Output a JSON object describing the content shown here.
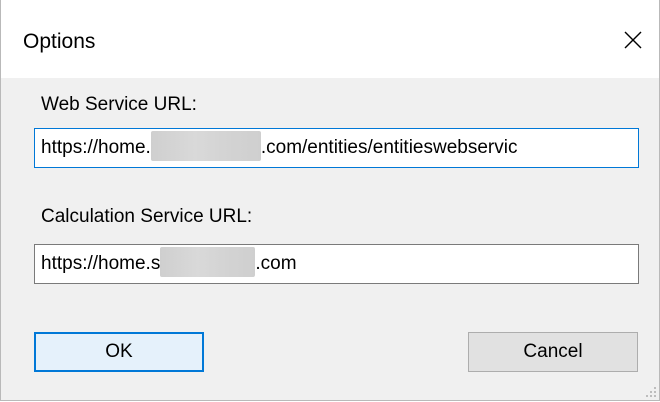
{
  "window": {
    "title": "Options"
  },
  "web_service": {
    "label": "Web Service URL:",
    "value_prefix": "https://home.",
    "value_suffix": ".com/entities/entitieswebservic"
  },
  "calculation_service": {
    "label": "Calculation Service URL:",
    "value_prefix": "https://home.s",
    "value_suffix": ".com"
  },
  "buttons": {
    "ok_label": "OK",
    "cancel_label": "Cancel"
  },
  "colors": {
    "focus_border": "#0078d7",
    "dialog_background": "#f0f0f0",
    "default_button_fill": "#e5f1fb"
  }
}
